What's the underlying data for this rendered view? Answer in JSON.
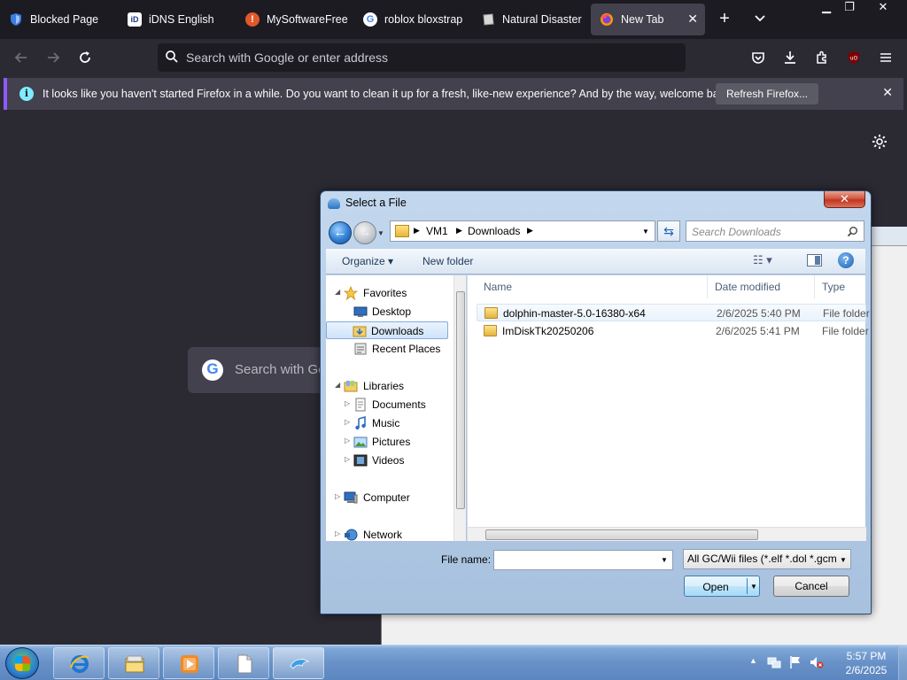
{
  "tabs": [
    {
      "title": "Blocked Page",
      "icon": "shield-icon"
    },
    {
      "title": "iDNS English",
      "icon": "idns-icon"
    },
    {
      "title": "MySoftwareFree",
      "icon": "mysoftware-icon"
    },
    {
      "title": "roblox bloxstrap",
      "icon": "google-icon"
    },
    {
      "title": "Natural Disaster",
      "icon": "page-icon"
    },
    {
      "title": "New Tab",
      "icon": "firefox-icon",
      "active": true
    }
  ],
  "urlbar": {
    "placeholder": "Search with Google or enter address"
  },
  "notification": {
    "text": "It looks like you haven't started Firefox in a while. Do you want to clean it up for a fresh, like-new experience? And by the way, welcome back!",
    "button_label": "Refresh Firefox..."
  },
  "newtab": {
    "search_placeholder": "Search with Go",
    "search_glyph": "G"
  },
  "dialog": {
    "title": "Select a File",
    "path": [
      "VM1",
      "Downloads"
    ],
    "search_placeholder": "Search Downloads",
    "toolbar": {
      "organize": "Organize ▾",
      "new_folder": "New folder"
    },
    "nav": {
      "favorites": "Favorites",
      "desktop": "Desktop",
      "downloads": "Downloads",
      "recent_places": "Recent Places",
      "libraries": "Libraries",
      "documents": "Documents",
      "music": "Music",
      "pictures": "Pictures",
      "videos": "Videos",
      "computer": "Computer",
      "network": "Network"
    },
    "columns": {
      "name": "Name",
      "date_modified": "Date modified",
      "type": "Type"
    },
    "files": [
      {
        "name": "dolphin-master-5.0-16380-x64",
        "date": "2/6/2025 5:40 PM",
        "type": "File folder"
      },
      {
        "name": "ImDiskTk20250206",
        "date": "2/6/2025 5:41 PM",
        "type": "File folder"
      }
    ],
    "file_name_label": "File name:",
    "file_name_value": "",
    "filter": "All GC/Wii files (*.elf *.dol *.gcm",
    "open_label": "Open",
    "cancel_label": "Cancel"
  },
  "taskbar": {
    "apps": [
      "internet-explorer-icon",
      "file-explorer-icon",
      "media-player-icon",
      "blank-document-icon",
      "dolphin-icon"
    ],
    "time": "5:57 PM",
    "date": "2/6/2025"
  },
  "colors": {
    "accent": "#9059ff",
    "firefox_bg": "#2b2a33",
    "tab_bar": "#1c1b22"
  }
}
